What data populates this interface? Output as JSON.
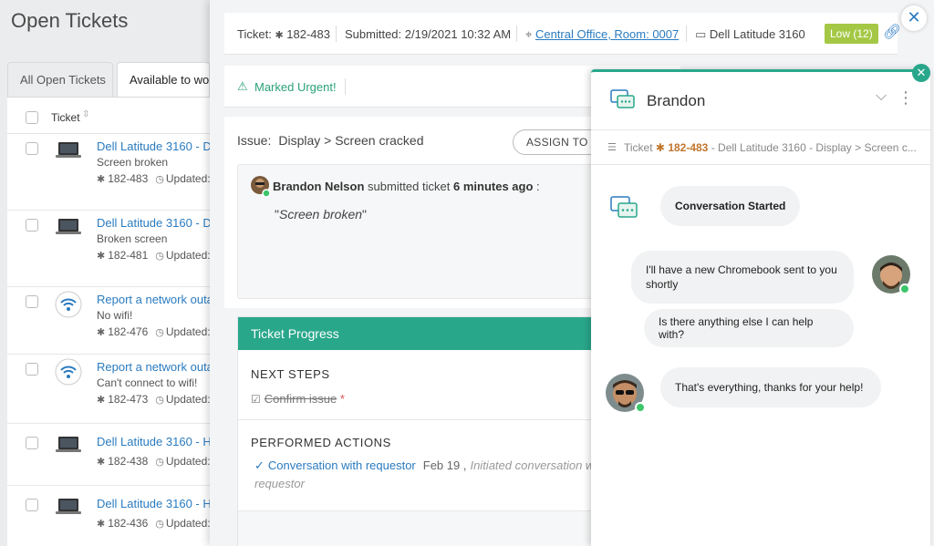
{
  "page": {
    "title": "Open Tickets"
  },
  "tabs": [
    {
      "label": "All Open Tickets"
    },
    {
      "label": "Available to wor"
    }
  ],
  "list": {
    "column_header": "Ticket",
    "rows": [
      {
        "title": "Dell Latitude 3160 - D",
        "subtitle": "Screen broken",
        "id": "182-483",
        "updated": "Updated:",
        "icon": "laptop-icon"
      },
      {
        "title": "Dell Latitude 3160 - D",
        "subtitle": "Broken screen",
        "id": "182-481",
        "updated": "Updated:",
        "icon": "laptop-icon"
      },
      {
        "title": "Report a network outa",
        "subtitle": "No wifi!",
        "id": "182-476",
        "updated": "Updated:",
        "icon": "wifi-icon"
      },
      {
        "title": "Report a network outa",
        "subtitle": "Can't connect to wifi!",
        "id": "182-473",
        "updated": "Updated:",
        "icon": "wifi-icon"
      },
      {
        "title": "Dell Latitude 3160 - H",
        "subtitle": "",
        "id": "182-438",
        "updated": "Updated:",
        "icon": "laptop-icon"
      },
      {
        "title": "Dell Latitude 3160 - H",
        "subtitle": "",
        "id": "182-436",
        "updated": "Updated:",
        "icon": "laptop-icon"
      }
    ]
  },
  "ticket": {
    "label": "Ticket:",
    "id": "182-483",
    "submitted": "Submitted: 2/19/2021 10:32 AM",
    "location": "Central Office, Room: 0007",
    "device": "Dell Latitude 3160",
    "priority": "Low (12)",
    "urgent": "Marked Urgent!",
    "issue_label": "Issue:",
    "issue_value": "Display > Screen cracked",
    "assign_button": "ASSIGN TO M",
    "comment": {
      "author": "Brandon Nelson",
      "action": "submitted ticket",
      "time": "6 minutes ago",
      "suffix": ":",
      "quote_open": "\"",
      "quote": "Screen broken",
      "quote_close": "\""
    }
  },
  "progress": {
    "title": "Ticket Progress",
    "next_steps": "NEXT STEPS",
    "step": "Confirm issue",
    "step_star": "*",
    "performed": "PERFORMED ACTIONS",
    "action_link": "Conversation with requestor",
    "action_date": "Feb 19 ,",
    "action_note": "Initiated conversation w",
    "action_note2": "requestor"
  },
  "chat": {
    "name": "Brandon",
    "sub_label": "Ticket",
    "sub_id": "182-483",
    "sub_rest": "- Dell Latitude 3160 - Display > Screen c...",
    "messages": [
      {
        "text": "Conversation Started"
      },
      {
        "text": "I'll have a new Chromebook sent to you shortly"
      },
      {
        "text": "Is there anything else I can help with?"
      },
      {
        "text": "That's everything, thanks for your help!"
      }
    ]
  },
  "colors": {
    "accent": "#29a78b",
    "link": "#2a7bc0",
    "priority": "#a4c845",
    "online": "#3cc66a"
  }
}
